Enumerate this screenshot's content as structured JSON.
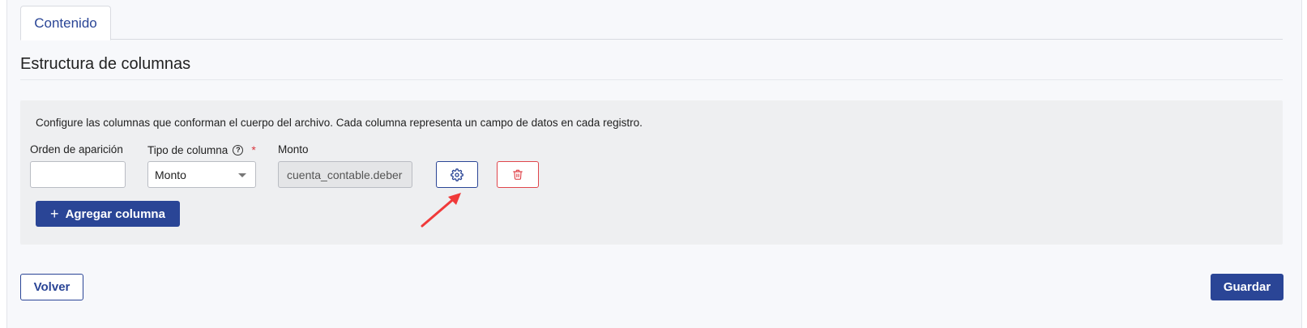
{
  "tabs": [
    {
      "label": "Contenido",
      "active": true
    }
  ],
  "section": {
    "title": "Estructura de columnas",
    "description": "Configure las columnas que conforman el cuerpo del archivo. Cada columna representa un campo de datos en cada registro."
  },
  "column_row": {
    "order_label": "Orden de aparición",
    "order_value": "",
    "type_label": "Tipo de columna",
    "type_help_icon": "help-circle-icon",
    "type_required_marker": "*",
    "type_value": "Monto",
    "monto_label": "Monto",
    "monto_value": "cuenta_contable.deber",
    "settings_icon": "gear-icon",
    "delete_icon": "trash-icon"
  },
  "actions": {
    "add_column_label": "Agregar columna",
    "back_label": "Volver",
    "save_label": "Guardar"
  },
  "colors": {
    "primary": "#2a4596",
    "danger": "#e0454b",
    "annotation_arrow": "#f03a3a",
    "panel_bg": "#eeeff1"
  }
}
